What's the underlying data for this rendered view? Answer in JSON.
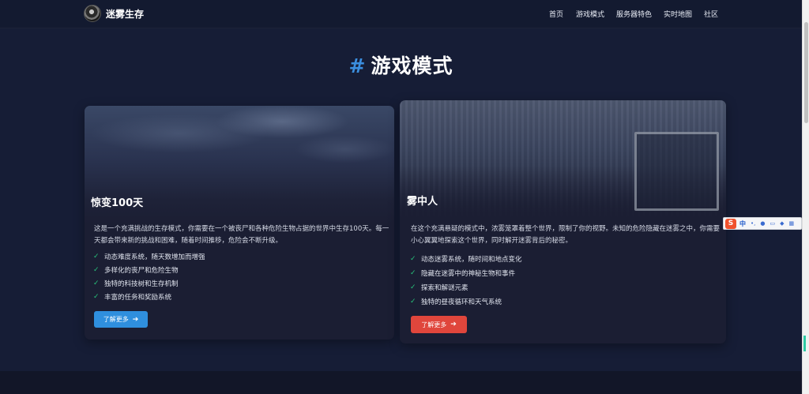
{
  "site": {
    "title": "迷雾生存"
  },
  "nav": {
    "items": [
      "首页",
      "游戏模式",
      "服务器特色",
      "实时地图",
      "社区"
    ]
  },
  "section": {
    "hash": "#",
    "title": "游戏模式"
  },
  "cards": [
    {
      "title": "惊变100天",
      "description": "这是一个充满挑战的生存模式，你需要在一个被丧尸和各种危险生物占据的世界中生存100天。每一天都会带来新的挑战和困难，随着时间推移，危险会不断升级。",
      "features": [
        "动态难度系统，随天数增加而增强",
        "多样化的丧尸和危险生物",
        "独特的科技树和生存机制",
        "丰富的任务和奖励系统"
      ],
      "button": "了解更多",
      "button_color": "#2f8fde"
    },
    {
      "title": "雾中人",
      "description": "在这个充满悬疑的模式中，浓雾笼罩着整个世界，限制了你的视野。未知的危险隐藏在迷雾之中，你需要小心翼翼地探索这个世界，同时解开迷雾背后的秘密。",
      "features": [
        "动态迷雾系统，随时间和地点变化",
        "隐藏在迷雾中的神秘生物和事件",
        "探索和解谜元素",
        "独特的昼夜循环和天气系统"
      ],
      "button": "了解更多",
      "button_color": "#e0463c"
    }
  ],
  "icons": {
    "feature": "check-icon",
    "button": "arrow-right-icon",
    "logo": "avatar-logo"
  },
  "colors": {
    "accent": "#3b8fe0",
    "check": "#27c27a",
    "background": "#161d36"
  },
  "ime": {
    "label": "中",
    "logo": "S"
  }
}
